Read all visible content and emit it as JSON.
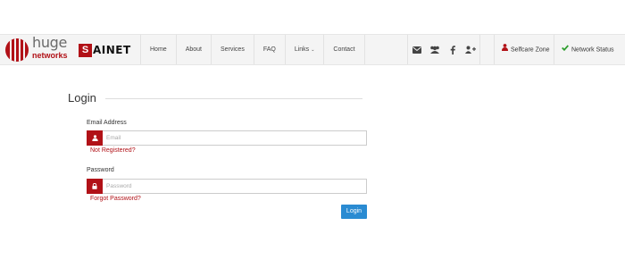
{
  "header": {
    "brand_primary": "huge",
    "brand_secondary": "networks",
    "partner_box": "S",
    "partner_text": "AINET",
    "nav": [
      {
        "label": "Home"
      },
      {
        "label": "About"
      },
      {
        "label": "Services"
      },
      {
        "label": "FAQ"
      },
      {
        "label": "Links"
      },
      {
        "label": "Contact"
      }
    ],
    "links_caret": "⌄",
    "social": [
      "envelope-icon",
      "users-icon",
      "facebook-icon",
      "google-plus-icon"
    ],
    "selfcare": "Selfcare Zone",
    "network_status": "Network Status"
  },
  "login": {
    "title": "Login",
    "email_label": "Email Address",
    "email_placeholder": "Email",
    "not_registered": "Not Registered?",
    "password_label": "Password",
    "password_placeholder": "Password",
    "forgot": "Forgot Password?",
    "submit": "Login"
  },
  "colors": {
    "brand_red": "#b11117",
    "button_blue": "#2a8bd2",
    "status_green": "#2e9e2e"
  }
}
